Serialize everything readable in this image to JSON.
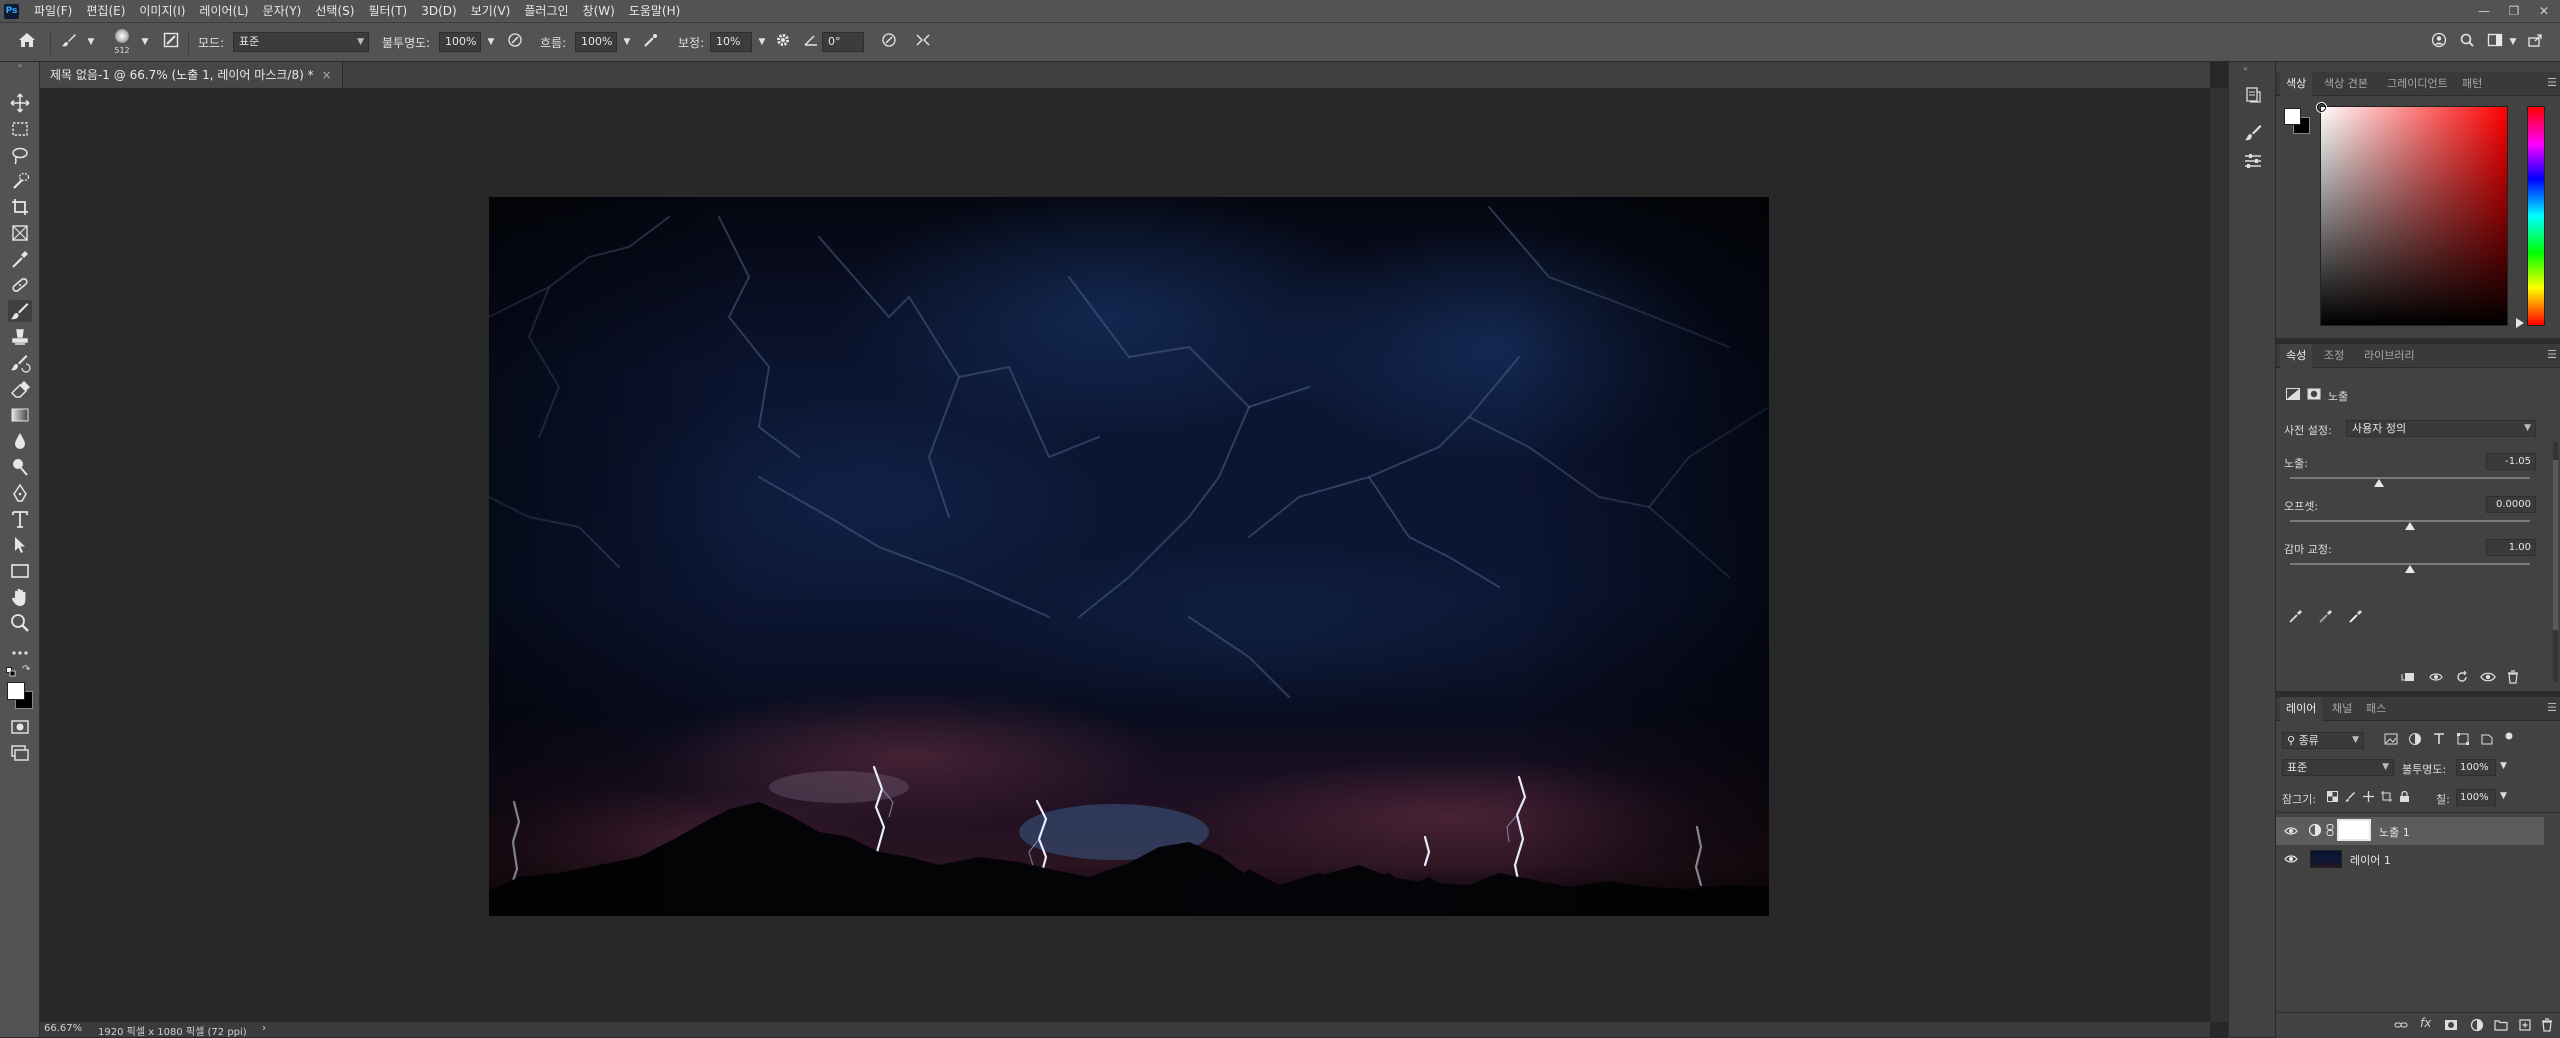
{
  "app": {
    "logo": "Ps"
  },
  "menu": [
    "파일(F)",
    "편집(E)",
    "이미지(I)",
    "레이어(L)",
    "문자(Y)",
    "선택(S)",
    "필터(T)",
    "3D(D)",
    "보기(V)",
    "플러그인",
    "창(W)",
    "도움말(H)"
  ],
  "window_controls": [
    "minimize-icon",
    "restore-icon",
    "close-icon"
  ],
  "options": {
    "brush_size": "512",
    "mode_label": "모드:",
    "mode_value": "표준",
    "opacity_label": "불투명도:",
    "opacity_value": "100%",
    "flow_label": "흐름:",
    "flow_value": "100%",
    "smoothing_label": "보정:",
    "smoothing_value": "10%",
    "angle_value": "0°"
  },
  "document": {
    "tab_title": "제목 없음-1 @ 66.7% (노출 1, 레이어 마스크/8) *",
    "zoom": "66.67%",
    "info": "1920 픽셀 x 1080 픽셀 (72 ppi)"
  },
  "color_panel": {
    "tabs": [
      "색상",
      "색상 견본",
      "그레이디언트",
      "패턴"
    ],
    "active_tab": 0,
    "foreground": "#ffffff",
    "background": "#000000",
    "hue": "#ff0000"
  },
  "properties_panel": {
    "tabs": [
      "속성",
      "조정",
      "라이브러리"
    ],
    "active_tab": 0,
    "adjustment_name": "노출",
    "preset_label": "사전 설정:",
    "preset_value": "사용자 정의",
    "exposure_label": "노출:",
    "exposure_value": "-1.05",
    "exposure_level": 0.37,
    "offset_label": "오프셋:",
    "offset_value": "0.0000",
    "offset_level": 0.5,
    "gamma_label": "감마 교정:",
    "gamma_value": "1.00",
    "gamma_level": 0.5
  },
  "layers_panel": {
    "tabs": [
      "레이어",
      "채널",
      "패스"
    ],
    "active_tab": 0,
    "filter_label": "종류",
    "blend_mode": "표준",
    "opacity_label": "불투명도:",
    "opacity_value": "100%",
    "lock_label": "잠그기:",
    "fill_label": "칠:",
    "fill_value": "100%",
    "layers": [
      {
        "name": "노출 1",
        "type": "adjustment",
        "selected": true
      },
      {
        "name": "레이어 1",
        "type": "image",
        "selected": false
      }
    ]
  },
  "colors": {
    "ui_bg": "#535353",
    "panel_bg": "#424242",
    "workspace": "#282828",
    "accent": "#31a8ff"
  }
}
